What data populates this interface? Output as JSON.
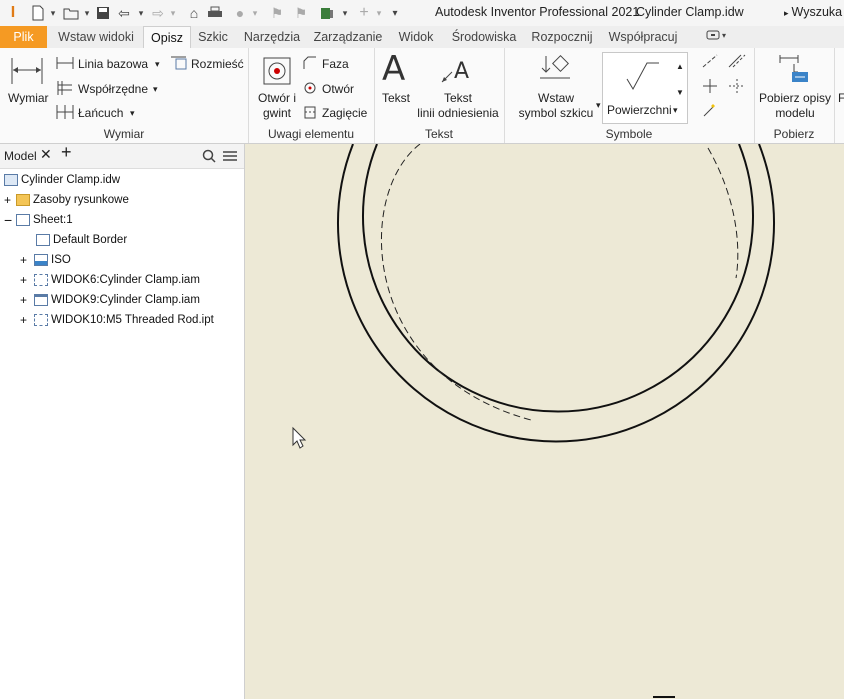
{
  "titlebar": {
    "app_title": "Autodesk Inventor Professional 2021",
    "file_title": "Cylinder Clamp.idw",
    "search_label": "Wyszuka"
  },
  "tabs": [
    {
      "label": "Plik"
    },
    {
      "label": "Wstaw widoki"
    },
    {
      "label": "Opisz"
    },
    {
      "label": "Szkic"
    },
    {
      "label": "Narzędzia"
    },
    {
      "label": "Zarządzanie"
    },
    {
      "label": "Widok"
    },
    {
      "label": "Środowiska"
    },
    {
      "label": "Rozpocznij"
    },
    {
      "label": "Współpracuj"
    }
  ],
  "ribbon": {
    "wymiar": {
      "label": "Wymiar",
      "group_label": "Wymiar",
      "linia_bazowa": "Linia bazowa",
      "rozmiesc": "Rozmieść",
      "wspolrzedne": "Współrzędne",
      "lancuch": "Łańcuch"
    },
    "uwagi": {
      "otwor_gwint_1": "Otwór i",
      "otwor_gwint_2": "gwint",
      "faza": "Faza",
      "otwor": "Otwór",
      "zagiecie": "Zagięcie",
      "group_label": "Uwagi elementu"
    },
    "tekst": {
      "tekst": "Tekst",
      "tekst_linii_1": "Tekst",
      "tekst_linii_2": "linii odniesienia",
      "group_label": "Tekst"
    },
    "symbole": {
      "wstaw_1": "Wstaw",
      "wstaw_2": "symbol szkicu",
      "powierzchni": "Powierzchni",
      "group_label": "Symbole"
    },
    "pobierz": {
      "label_1": "Pobierz opisy",
      "label_2": "modelu",
      "group_label": "Pobierz"
    }
  },
  "browser": {
    "tab_label": "Model",
    "tree": [
      {
        "label": "Cylinder Clamp.idw"
      },
      {
        "label": "Zasoby rysunkowe"
      },
      {
        "label": "Sheet:1"
      },
      {
        "label": "Default Border"
      },
      {
        "label": "ISO"
      },
      {
        "label": "WIDOK6:Cylinder Clamp.iam"
      },
      {
        "label": "WIDOK9:Cylinder Clamp.iam"
      },
      {
        "label": "WIDOK10:M5 Threaded Rod.ipt"
      }
    ]
  },
  "colors": {
    "file_tab": "#f59a23",
    "canvas": "#ede9d6",
    "accent_blue": "#3a83c8"
  }
}
